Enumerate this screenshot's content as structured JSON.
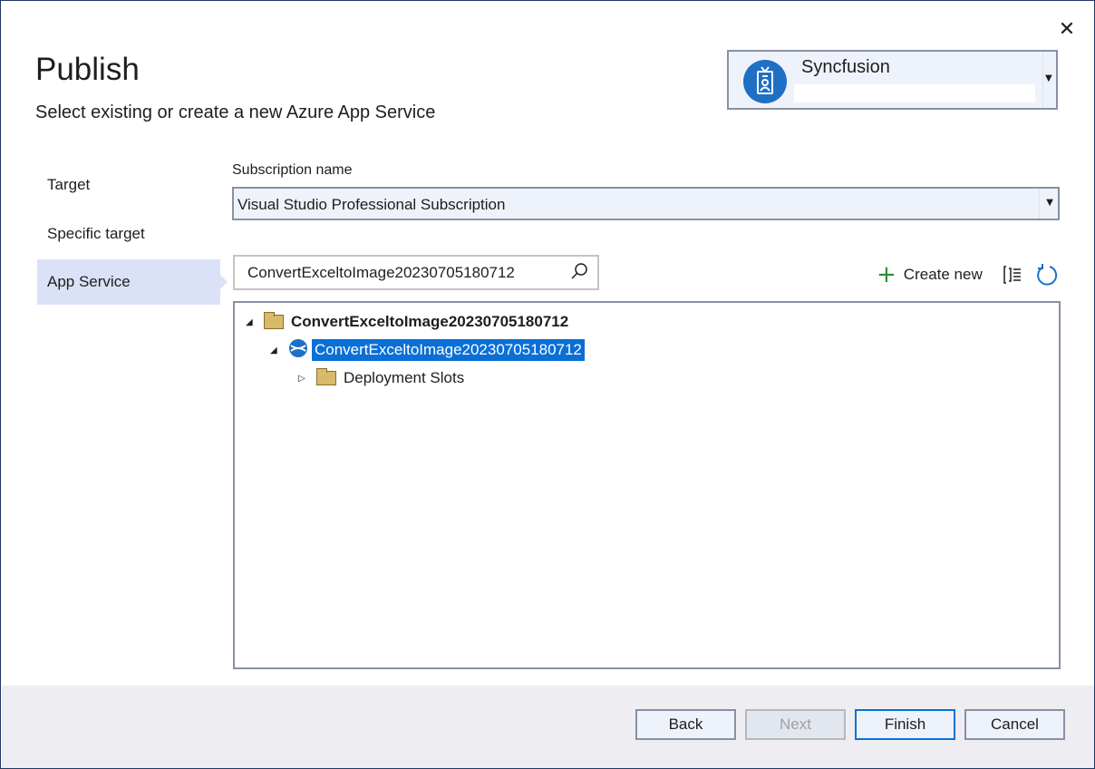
{
  "window": {
    "close_label": "✕"
  },
  "header": {
    "title": "Publish",
    "subtitle": "Select existing or create a new Azure App Service"
  },
  "account": {
    "name": "Syncfusion",
    "icon": "account-badge-icon"
  },
  "nav": {
    "items": [
      {
        "label": "Target",
        "active": false
      },
      {
        "label": "Specific target",
        "active": false
      },
      {
        "label": "App Service",
        "active": true
      }
    ]
  },
  "subscription": {
    "label": "Subscription name",
    "value": "Visual Studio Professional Subscription"
  },
  "search": {
    "value": "ConvertExceltoImage20230705180712",
    "icon": "search-icon"
  },
  "toolbar": {
    "create_new_label": "Create new",
    "view_icon": "tree-view-icon",
    "refresh_icon": "refresh-icon"
  },
  "tree": {
    "nodes": [
      {
        "label": "ConvertExceltoImage20230705180712",
        "type": "resource-group",
        "expanded": true,
        "level": 0
      },
      {
        "label": "ConvertExceltoImage20230705180712",
        "type": "app-service",
        "expanded": true,
        "level": 1,
        "selected": true
      },
      {
        "label": "Deployment Slots",
        "type": "folder",
        "expanded": false,
        "level": 2
      }
    ]
  },
  "footer": {
    "back_label": "Back",
    "next_label": "Next",
    "finish_label": "Finish",
    "cancel_label": "Cancel"
  }
}
